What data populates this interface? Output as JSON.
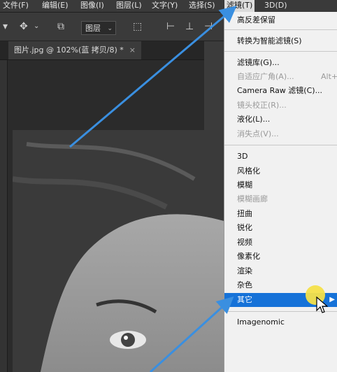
{
  "menubar": {
    "items": [
      {
        "label": "文件(F)"
      },
      {
        "label": "编辑(E)"
      },
      {
        "label": "图像(I)"
      },
      {
        "label": "图层(L)"
      },
      {
        "label": "文字(Y)"
      },
      {
        "label": "选择(S)"
      },
      {
        "label": "滤镜(T)"
      },
      {
        "label": "3D(D)"
      }
    ]
  },
  "options_bar": {
    "layer_select": "图层"
  },
  "document_tab": {
    "title": "图片.jpg @ 102%(蓝 拷贝/8) *",
    "close": "×"
  },
  "menu": {
    "items": [
      {
        "label": "高反差保留",
        "enabled": true
      },
      {
        "label": "转换为智能滤镜(S)",
        "enabled": true
      },
      {
        "label": "滤镜库(G)...",
        "enabled": true
      },
      {
        "label": "自适应广角(A)...",
        "enabled": false,
        "shortcut": "Alt+"
      },
      {
        "label": "Camera Raw 滤镜(C)...",
        "enabled": true
      },
      {
        "label": "镜头校正(R)...",
        "enabled": false
      },
      {
        "label": "液化(L)...",
        "enabled": true
      },
      {
        "label": "消失点(V)...",
        "enabled": false
      },
      {
        "label": "3D",
        "enabled": true
      },
      {
        "label": "风格化",
        "enabled": true
      },
      {
        "label": "模糊",
        "enabled": true
      },
      {
        "label": "模糊画廊",
        "enabled": false
      },
      {
        "label": "扭曲",
        "enabled": true
      },
      {
        "label": "锐化",
        "enabled": true
      },
      {
        "label": "视频",
        "enabled": true
      },
      {
        "label": "像素化",
        "enabled": true
      },
      {
        "label": "渲染",
        "enabled": true
      },
      {
        "label": "杂色",
        "enabled": true
      },
      {
        "label": "其它",
        "enabled": true,
        "highlighted": true
      },
      {
        "label": "Imagenomic",
        "enabled": true
      }
    ]
  },
  "colors": {
    "menu_highlight": "#1672d8",
    "annotation_arrow": "#3a8fe0",
    "cursor_highlight": "#f4e04a"
  },
  "icons": [
    "move-icon",
    "layer-stack-icon",
    "align-icon",
    "eye-icon",
    "mouse-pointer-icon"
  ]
}
